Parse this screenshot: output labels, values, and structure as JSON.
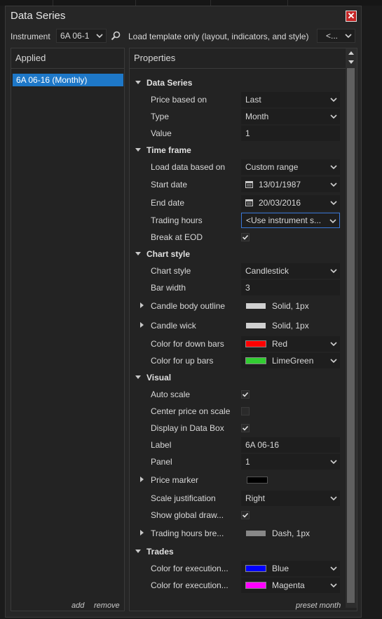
{
  "window": {
    "title": "Data Series"
  },
  "toolbar": {
    "instrument_label": "Instrument",
    "instrument_value": "6A 06-1",
    "template_label": "Load template only (layout, indicators, and style)",
    "template_value": "<..."
  },
  "applied": {
    "header": "Applied",
    "items": [
      "6A 06-16 (Monthly)"
    ],
    "add_label": "add",
    "remove_label": "remove"
  },
  "properties": {
    "header": "Properties",
    "preset_label": "preset month",
    "categories": [
      {
        "label": "Data Series",
        "rows": [
          {
            "name": "Price based on",
            "type": "combo",
            "value": "Last"
          },
          {
            "name": "Type",
            "type": "combo",
            "value": "Month"
          },
          {
            "name": "Value",
            "type": "text",
            "value": "1"
          }
        ]
      },
      {
        "label": "Time frame",
        "rows": [
          {
            "name": "Load data based on",
            "type": "combo",
            "value": "Custom range"
          },
          {
            "name": "Start date",
            "type": "date",
            "value": "13/01/1987"
          },
          {
            "name": "End date",
            "type": "date",
            "value": "20/03/2016"
          },
          {
            "name": "Trading hours",
            "type": "combo-selected",
            "value": "<Use instrument s..."
          },
          {
            "name": "Break at EOD",
            "type": "check",
            "checked": true
          }
        ]
      },
      {
        "label": "Chart style",
        "rows": [
          {
            "name": "Chart style",
            "type": "combo",
            "value": "Candlestick"
          },
          {
            "name": "Bar width",
            "type": "text",
            "value": "3"
          },
          {
            "name": "Candle body outline",
            "type": "stroke",
            "value": "Solid, 1px",
            "expandable": true,
            "color": "#d0d0d0"
          },
          {
            "name": "Candle wick",
            "type": "stroke",
            "value": "Solid, 1px",
            "expandable": true,
            "color": "#d0d0d0"
          },
          {
            "name": "Color for down bars",
            "type": "color",
            "value": "Red",
            "color": "#ff0000"
          },
          {
            "name": "Color for up bars",
            "type": "color",
            "value": "LimeGreen",
            "color": "#32cd32"
          }
        ]
      },
      {
        "label": "Visual",
        "rows": [
          {
            "name": "Auto scale",
            "type": "check",
            "checked": true
          },
          {
            "name": "Center price on scale",
            "type": "check",
            "checked": false
          },
          {
            "name": "Display in Data Box",
            "type": "check",
            "checked": true
          },
          {
            "name": "Label",
            "type": "text",
            "value": "6A 06-16"
          },
          {
            "name": "Panel",
            "type": "combo",
            "value": "1"
          },
          {
            "name": "Price marker",
            "type": "swatch-only",
            "expandable": true,
            "color": "#000000"
          },
          {
            "name": "Scale justification",
            "type": "combo",
            "value": "Right"
          },
          {
            "name": "Show global draw...",
            "type": "check",
            "checked": true
          },
          {
            "name": "Trading hours bre...",
            "type": "stroke",
            "value": "Dash, 1px",
            "expandable": true,
            "color": "#888888"
          }
        ]
      },
      {
        "label": "Trades",
        "rows": [
          {
            "name": "Color for execution...",
            "type": "color",
            "value": "Blue",
            "color": "#0000ff"
          },
          {
            "name": "Color for execution...",
            "type": "color",
            "value": "Magenta",
            "color": "#ff00ff"
          }
        ]
      }
    ]
  },
  "colors": {
    "accent": "#1e78c8",
    "close": "#c42525",
    "selection_border": "#3a78d8"
  }
}
